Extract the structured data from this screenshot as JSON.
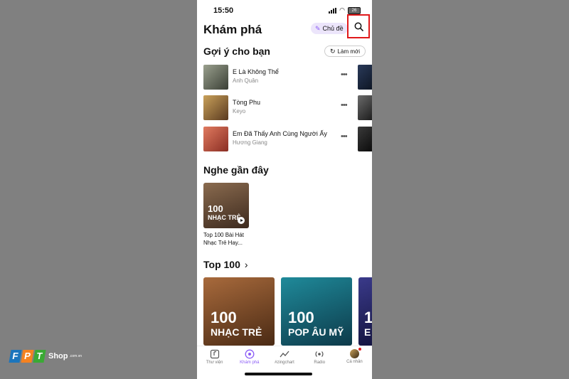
{
  "status_bar": {
    "time": "15:50",
    "battery": "26"
  },
  "header": {
    "title": "Khám phá",
    "theme_label": "Chủ đề"
  },
  "suggest": {
    "title": "Gợi ý cho bạn",
    "refresh_label": "Làm mới",
    "songs": [
      {
        "title": "E Là Không Thể",
        "artist": "Anh Quân"
      },
      {
        "title": "Tòng Phu",
        "artist": "Keyo"
      },
      {
        "title": "Em Đã Thấy Anh Cùng Người Ấy",
        "artist": "Hương Giang"
      }
    ],
    "more_label": "•••"
  },
  "recent": {
    "title": "Nghe gần đây",
    "item": {
      "cover_line1": "100",
      "cover_line2": "NHẠC TRẺ",
      "caption": "Top 100 Bài Hát Nhạc Trẻ Hay..."
    }
  },
  "top100": {
    "title": "Top 100",
    "arrow": "›",
    "cards": [
      {
        "line1": "100",
        "line2": "NHẠC TRẺ"
      },
      {
        "line1": "100",
        "line2": "POP ÂU MỸ"
      },
      {
        "line1": "1",
        "line2": "E"
      }
    ]
  },
  "nav": {
    "items": [
      {
        "label": "Thư viện",
        "icon": "library-icon"
      },
      {
        "label": "Khám phá",
        "icon": "discover-icon"
      },
      {
        "label": "#zingchart",
        "icon": "chart-icon"
      },
      {
        "label": "Radio",
        "icon": "radio-icon"
      },
      {
        "label": "Cá nhân",
        "icon": "profile-icon"
      }
    ]
  },
  "watermark": {
    "letters": [
      "F",
      "P",
      "T"
    ],
    "shop": "Shop",
    "domain": ".com.vn"
  },
  "colors": {
    "accent": "#8b5cf6",
    "highlight_border": "#e0191b",
    "background": "#808080"
  }
}
